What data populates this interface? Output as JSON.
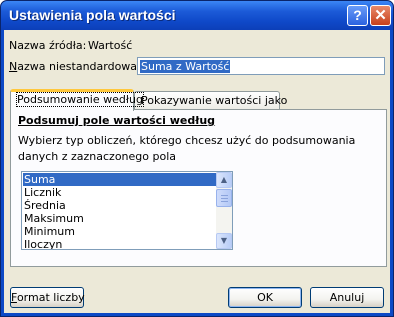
{
  "window": {
    "title": "Ustawienia pola wartości",
    "help_label": "?",
    "close_label": "✕"
  },
  "source": {
    "label": "Nazwa źródła:",
    "value": "Wartość"
  },
  "custom_name": {
    "label_before": "",
    "label_access": "N",
    "label_after": "azwa niestandardowa:",
    "value": "Suma z Wartość"
  },
  "tabs": [
    {
      "label": "Podsumowanie według",
      "active": true
    },
    {
      "label": "Pokazywanie wartości jako",
      "active": false
    }
  ],
  "summarize": {
    "heading": "Podsumuj pole wartości według",
    "description_line1": "Wybierz typ obliczeń, którego chcesz użyć do podsumowania",
    "description_line2": "danych z zaznaczonego pola",
    "items": [
      "Suma",
      "Licznik",
      "Średnia",
      "Maksimum",
      "Minimum",
      "Iloczyn"
    ],
    "selected": "Suma"
  },
  "buttons": {
    "number_format_access": "F",
    "number_format_rest": "ormat liczby",
    "ok": "OK",
    "cancel": "Anuluj"
  }
}
